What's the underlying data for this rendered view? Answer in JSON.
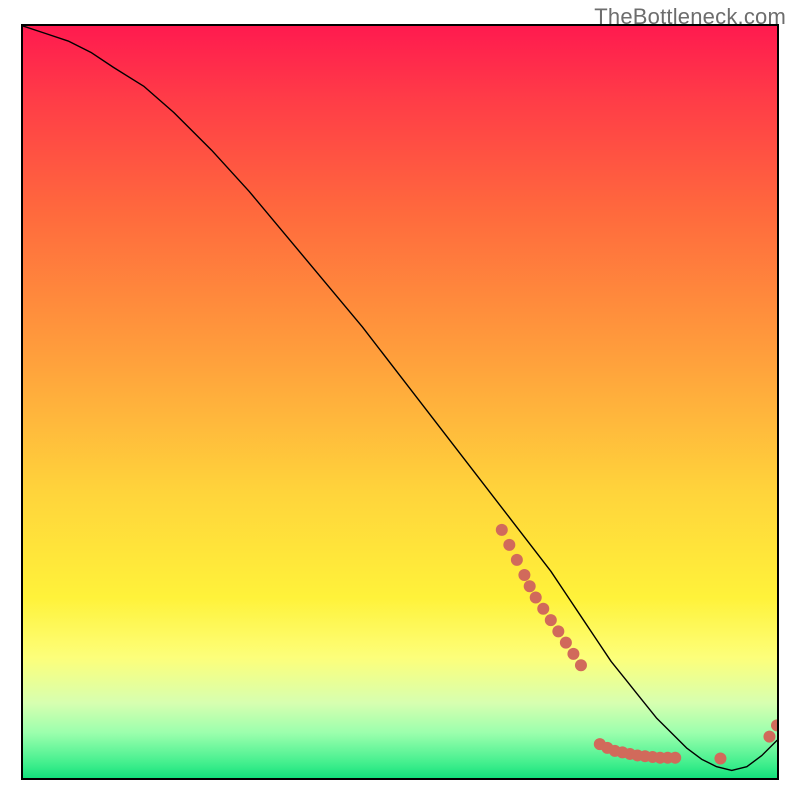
{
  "watermark": "TheBottleneck.com",
  "colors": {
    "gradient_top": "#ff1a4f",
    "gradient_mid": "#ffd43b",
    "gradient_bottom": "#13e17c",
    "curve": "#000000",
    "dot": "#d16a5b",
    "border": "#000000"
  },
  "chart_data": {
    "type": "line",
    "title": "",
    "xlabel": "",
    "ylabel": "",
    "xlim": [
      0,
      100
    ],
    "ylim": [
      0,
      100
    ],
    "grid": false,
    "legend_position": "none",
    "series": [
      {
        "name": "bottleneck-curve",
        "x": [
          0,
          3,
          6,
          9,
          12,
          16,
          20,
          25,
          30,
          35,
          40,
          45,
          50,
          55,
          60,
          65,
          70,
          72,
          74,
          76,
          78,
          80,
          82,
          84,
          86,
          88,
          90,
          92,
          94,
          96,
          98,
          100
        ],
        "y": [
          100,
          99,
          98,
          96.5,
          94.5,
          92,
          88.5,
          83.5,
          78,
          72,
          66,
          60,
          53.5,
          47,
          40.5,
          34,
          27.5,
          24.5,
          21.5,
          18.5,
          15.5,
          13,
          10.5,
          8,
          6,
          4,
          2.5,
          1.5,
          1,
          1.5,
          3,
          5
        ]
      }
    ],
    "dots": {
      "name": "scatter-markers",
      "points": [
        {
          "x": 63.5,
          "y": 33.0
        },
        {
          "x": 64.5,
          "y": 31.0
        },
        {
          "x": 65.5,
          "y": 29.0
        },
        {
          "x": 66.5,
          "y": 27.0
        },
        {
          "x": 67.2,
          "y": 25.5
        },
        {
          "x": 68.0,
          "y": 24.0
        },
        {
          "x": 69.0,
          "y": 22.5
        },
        {
          "x": 70.0,
          "y": 21.0
        },
        {
          "x": 71.0,
          "y": 19.5
        },
        {
          "x": 72.0,
          "y": 18.0
        },
        {
          "x": 73.0,
          "y": 16.5
        },
        {
          "x": 74.0,
          "y": 15.0
        },
        {
          "x": 76.5,
          "y": 4.5
        },
        {
          "x": 77.5,
          "y": 4.0
        },
        {
          "x": 78.5,
          "y": 3.6
        },
        {
          "x": 79.5,
          "y": 3.4
        },
        {
          "x": 80.5,
          "y": 3.2
        },
        {
          "x": 81.5,
          "y": 3.0
        },
        {
          "x": 82.5,
          "y": 2.9
        },
        {
          "x": 83.5,
          "y": 2.8
        },
        {
          "x": 84.5,
          "y": 2.7
        },
        {
          "x": 85.5,
          "y": 2.7
        },
        {
          "x": 86.5,
          "y": 2.7
        },
        {
          "x": 92.5,
          "y": 2.6
        },
        {
          "x": 99.0,
          "y": 5.5
        },
        {
          "x": 100.0,
          "y": 7.0
        }
      ]
    }
  }
}
